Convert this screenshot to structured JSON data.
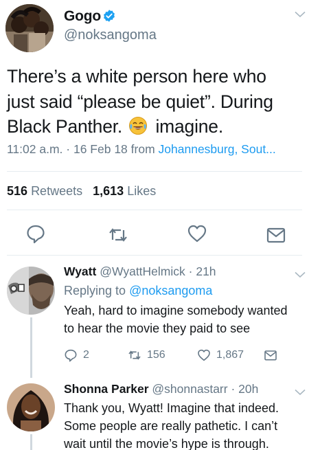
{
  "main_tweet": {
    "display_name": "Gogo",
    "handle": "@noksangoma",
    "text_lines": [
      "There’s a white person here who",
      "just said “please be quiet”. During",
      "Black Panther.",
      "imagine."
    ],
    "time": "11:02 a.m.",
    "date": "16 Feb 18",
    "from_label": "from",
    "location": "Johannesburg, Sout...",
    "retweets_count": "516",
    "retweets_label": "Retweets",
    "likes_count": "1,613",
    "likes_label": "Likes"
  },
  "replies": [
    {
      "display_name": "Wyatt",
      "handle": "@WyattHelmick",
      "age": "21h",
      "replying_prefix": "Replying to",
      "replying_to": "@noksangoma",
      "text_lines": [
        "Yeah, hard to imagine somebody wanted",
        "to hear the movie they paid to see"
      ],
      "replies_count": "2",
      "retweets_count": "156",
      "likes_count": "1,867"
    },
    {
      "display_name": "Shonna Parker",
      "handle": "@shonnastarr",
      "age": "20h",
      "text_lines": [
        "Thank you, Wyatt! Imagine that indeed.",
        "Some people are really pathetic. I can’t",
        "wait until the movie’s hype is through."
      ]
    }
  ],
  "separator_dot": "·",
  "colors": {
    "link_blue": "#1d9bf0",
    "secondary_gray": "#657786",
    "divider": "#e6ecf0",
    "verified_blue": "#1da1f2"
  },
  "icons": [
    "verified-badge-icon",
    "chevron-down-icon",
    "reply-icon",
    "retweet-icon",
    "heart-icon",
    "message-icon",
    "tears-of-joy-emoji"
  ]
}
